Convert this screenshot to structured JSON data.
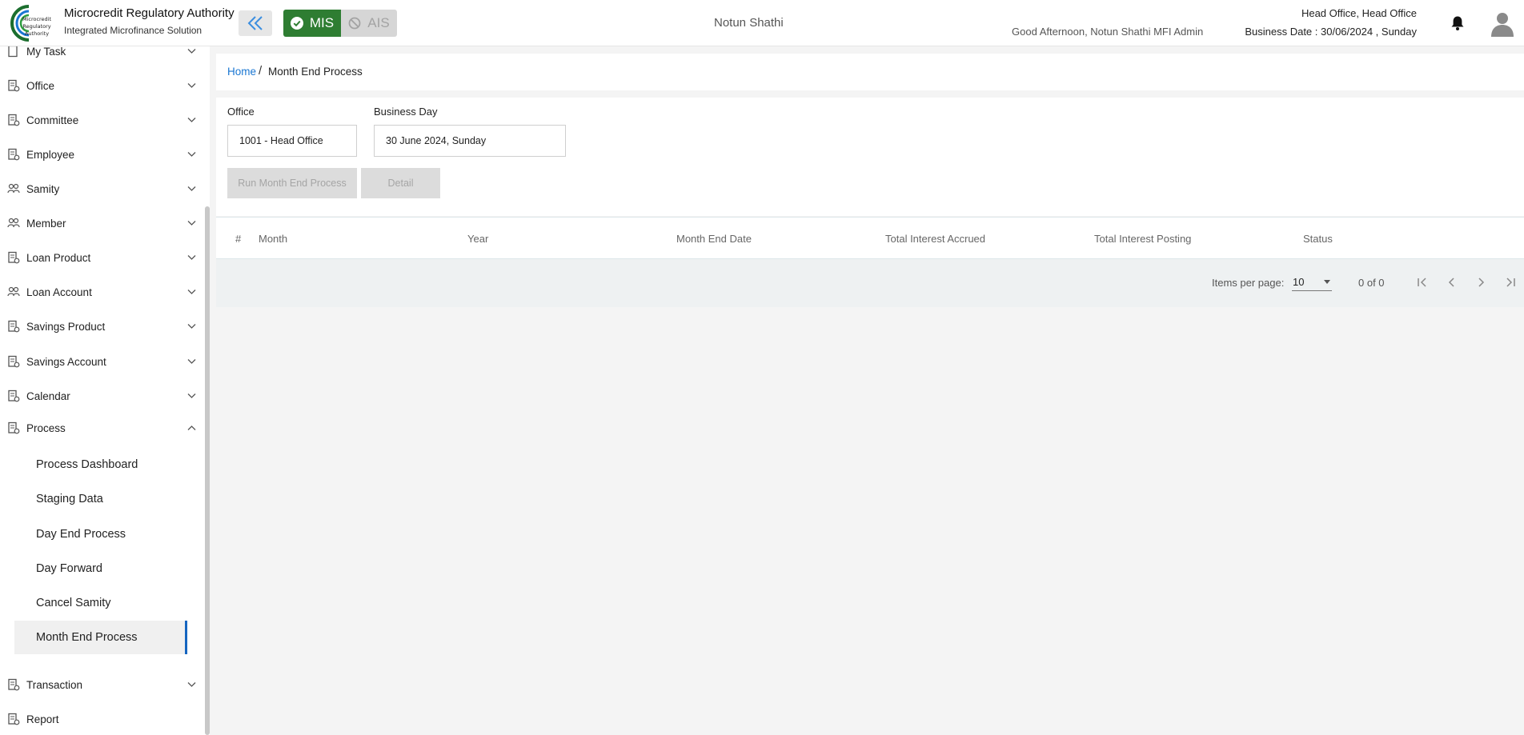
{
  "header": {
    "org_title": "Microcredit Regulatory Authority",
    "org_subtitle": "Integrated Microfinance Solution",
    "logo_text": "Microcredit Regulatory Authority",
    "mis_label": "MIS",
    "ais_label": "AIS",
    "center_title": "Notun Shathi",
    "greeting": "Good Afternoon, Notun Shathi MFI Admin",
    "office": "Head Office, Head Office",
    "business_date": "Business Date : 30/06/2024 , Sunday",
    "accent_color": "#2e7d32"
  },
  "sidebar": {
    "items": [
      {
        "label": "My Task",
        "icon": "task-icon"
      },
      {
        "label": "Office",
        "icon": "office-icon"
      },
      {
        "label": "Committee",
        "icon": "committee-icon"
      },
      {
        "label": "Employee",
        "icon": "employee-icon"
      },
      {
        "label": "Samity",
        "icon": "samity-icon"
      },
      {
        "label": "Member",
        "icon": "member-icon"
      },
      {
        "label": "Loan Product",
        "icon": "loan-product-icon"
      },
      {
        "label": "Loan Account",
        "icon": "loan-account-icon"
      },
      {
        "label": "Savings Product",
        "icon": "savings-product-icon"
      },
      {
        "label": "Savings Account",
        "icon": "savings-account-icon"
      },
      {
        "label": "Calendar",
        "icon": "calendar-icon"
      },
      {
        "label": "Process",
        "icon": "process-icon"
      },
      {
        "label": "Transaction",
        "icon": "transaction-icon"
      },
      {
        "label": "Report",
        "icon": "report-icon"
      }
    ],
    "process_sub": [
      "Process Dashboard",
      "Staging Data",
      "Day End Process",
      "Day Forward",
      "Cancel Samity",
      "Month End Process"
    ],
    "active_color": "#1565c0"
  },
  "breadcrumb": {
    "home": "Home",
    "separator": "/",
    "current": "Month End Process"
  },
  "form": {
    "office_label": "Office",
    "office_value": "1001 - Head Office",
    "business_day_label": "Business Day",
    "business_day_value": "30 June 2024, Sunday",
    "run_button": "Run Month End Process",
    "detail_button": "Detail"
  },
  "table": {
    "columns": [
      "#",
      "Month",
      "Year",
      "Month End Date",
      "Total Interest Accrued",
      "Total Interest Posting",
      "Status"
    ],
    "rows": []
  },
  "paginator": {
    "items_per_page_label": "Items per page:",
    "items_per_page": "10",
    "range": "0 of 0"
  }
}
